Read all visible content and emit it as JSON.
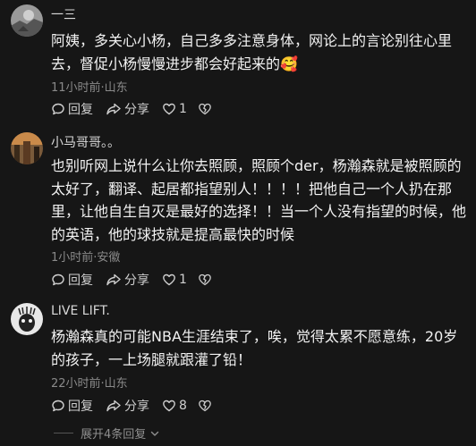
{
  "comments": [
    {
      "username": "一三",
      "body": "阿姨，多关心小杨，自己多多注意身体，网论上的言论别往心里去，督促小杨慢慢进步都会好起来的",
      "emoji": "🥰",
      "meta": "11小时前·山东",
      "reply": "回复",
      "share": "分享",
      "likes": "1"
    },
    {
      "username": "小马哥哥。。",
      "body": "也别听网上说什么让你去照顾，照顾个der，杨瀚森就是被照顾的太好了，翻译、起居都指望别人！！！！把他自己一个人扔在那里，让他自生自灭是最好的选择！！当一个人没有指望的时候，他的英语，他的球技就是提高最快的时候",
      "meta": "1小时前·安徽",
      "reply": "回复",
      "share": "分享",
      "likes": "1"
    },
    {
      "username": "LIVE LIFT.",
      "body": "杨瀚森真的可能NBA生涯结束了，唉，觉得太累不愿意练，20岁的孩子，一上场腿就跟灌了铅！",
      "meta": "22小时前·山东",
      "reply": "回复",
      "share": "分享",
      "likes": "8"
    }
  ],
  "expand_replies": "展开4条回复",
  "colors": {
    "background": "#161616",
    "text": "#f2f2f2",
    "muted": "#8a8a8a"
  }
}
